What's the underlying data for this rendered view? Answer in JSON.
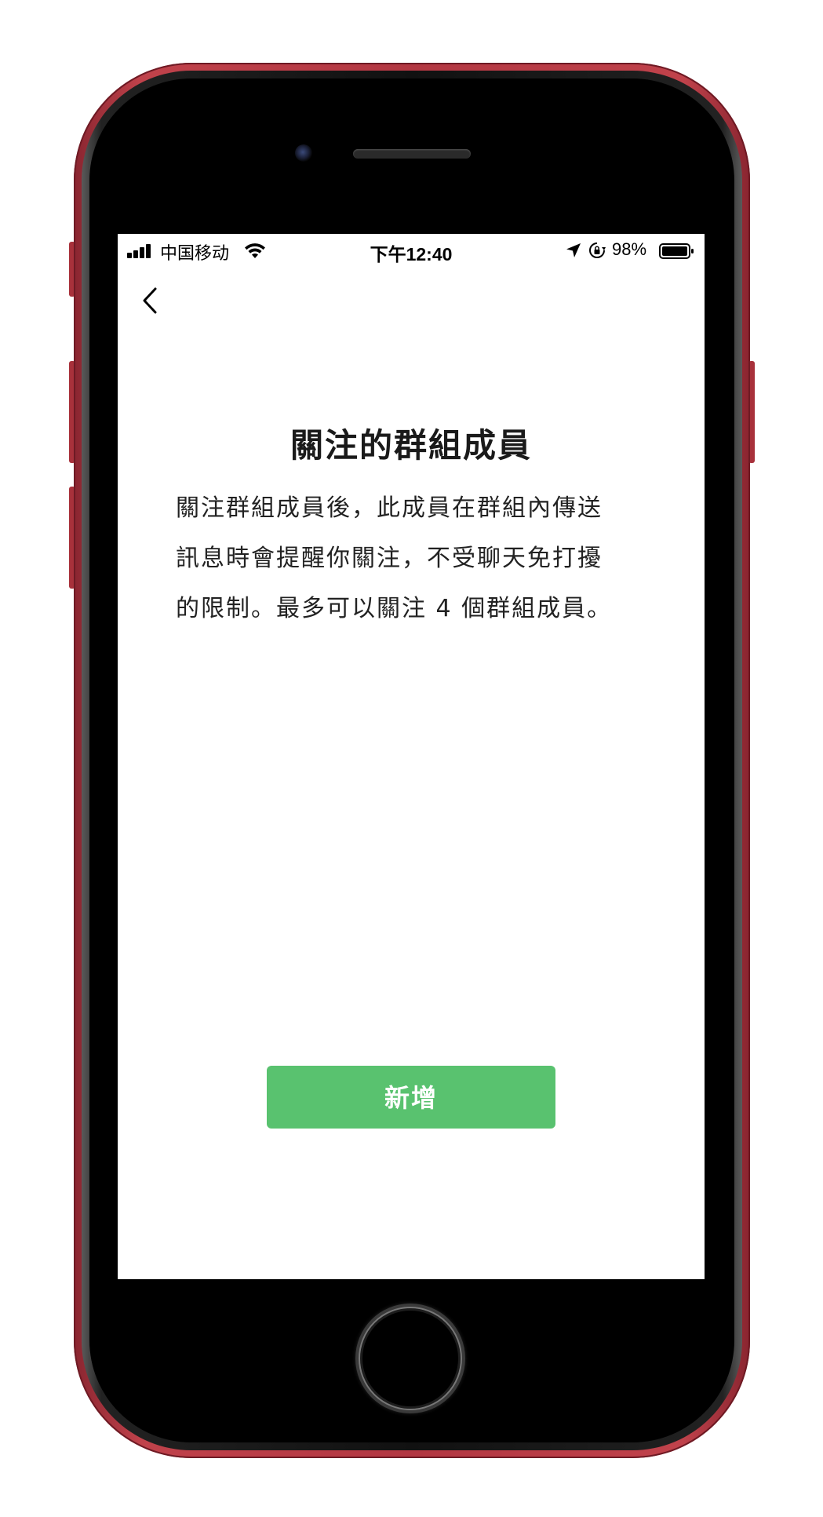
{
  "status_bar": {
    "carrier": "中国移动",
    "time": "下午12:40",
    "battery_percent": "98%",
    "icons": [
      "signal-bars-icon",
      "wifi-icon",
      "location-arrow-icon",
      "rotation-lock-icon",
      "battery-icon"
    ]
  },
  "nav": {
    "back_icon": "chevron-left-icon"
  },
  "content": {
    "title": "關注的群組成員",
    "description_lines": [
      "關注群組成員後，此成員在群組內傳送",
      "訊息時會提醒你關注，不受聊天免打擾",
      "的限制。最多可以關注 4 個群組成員。"
    ],
    "add_button_label": "新增"
  },
  "colors": {
    "accent_green": "#59c26f",
    "phone_body": "#b23742"
  }
}
